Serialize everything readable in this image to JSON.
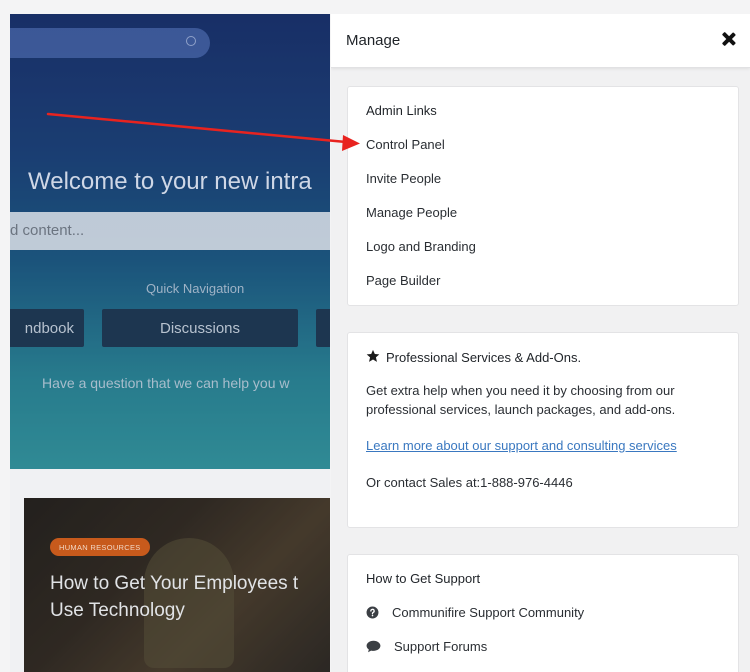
{
  "background_page": {
    "hero_welcome": "Welcome to your new intra",
    "content_search_placeholder": "d content...",
    "quick_navigation_label": "Quick Navigation",
    "quick_nav_buttons": [
      "ndbook",
      "Discussions",
      ""
    ],
    "question_text": "Have a question that we can help you w",
    "article": {
      "category_badge": "HUMAN RESOURCES",
      "title_line1": "How to Get Your Employees t",
      "title_line2": "Use Technology"
    }
  },
  "panel": {
    "title": "Manage",
    "close_icon": "close-icon",
    "admin_links": {
      "heading": "Admin Links",
      "items": [
        "Control Panel",
        "Invite People",
        "Manage People",
        "Logo and Branding",
        "Page Builder"
      ]
    },
    "professional_services": {
      "icon": "star-icon",
      "heading": "Professional Services & Add-Ons.",
      "description": "Get extra help when you need it by choosing from our professional services, launch packages, and add-ons.",
      "link_text": "Learn more about our support and consulting services",
      "sales_text": "Or contact Sales at:1-888-976-4446"
    },
    "support": {
      "heading": "How to Get Support",
      "items": [
        {
          "icon": "question-circle-icon",
          "label": "Communifire Support Community"
        },
        {
          "icon": "chat-bubble-icon",
          "label": "Support Forums"
        }
      ]
    }
  },
  "annotation": {
    "arrow_color": "#e8231f",
    "target": "Control Panel"
  },
  "colors": {
    "link": "#3a78c0",
    "badge": "#c75a1c",
    "hero_top": "#17367f",
    "hero_bottom": "#38b5bf"
  }
}
